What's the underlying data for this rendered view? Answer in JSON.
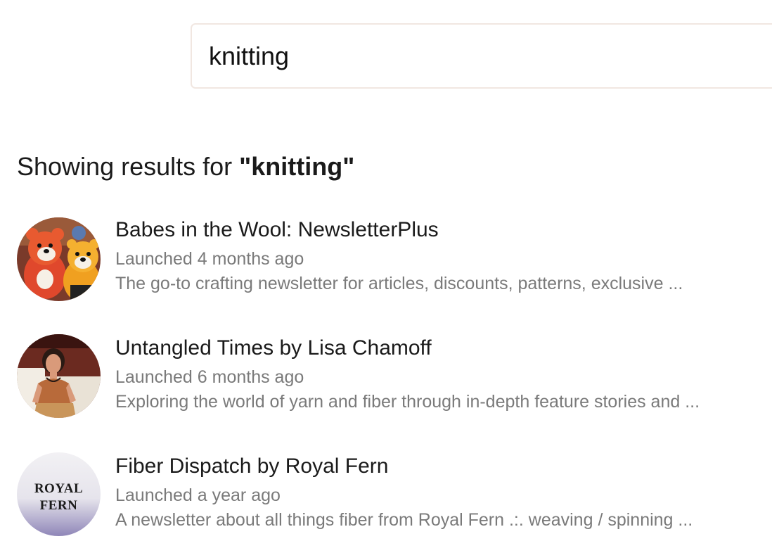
{
  "search": {
    "value": "knitting"
  },
  "results_heading": {
    "prefix": "Showing results for ",
    "query": "\"knitting\""
  },
  "results": [
    {
      "title": "Babes in the Wool: NewsletterPlus",
      "launched": "Launched 4 months ago",
      "description": "The go-to crafting newsletter for articles, discounts, patterns, exclusive ...",
      "avatar_icon": "knitted-toys-avatar-icon"
    },
    {
      "title": "Untangled Times by Lisa Chamoff",
      "launched": "Launched 6 months ago",
      "description": "Exploring the world of yarn and fiber through in-depth feature stories and ...",
      "avatar_icon": "person-portrait-avatar-icon"
    },
    {
      "title": "Fiber Dispatch by Royal Fern",
      "launched": "Launched a year ago",
      "description": "A newsletter about all things fiber from Royal Fern .:. weaving / spinning ...",
      "avatar_icon": "royal-fern-logo-avatar-icon",
      "avatar_logo_text": [
        "ROYAL",
        "FERN"
      ]
    }
  ],
  "colors": {
    "search_border": "#f1e7e1",
    "title_text": "#1a1a1a",
    "secondary_text": "#7a7a7a"
  }
}
